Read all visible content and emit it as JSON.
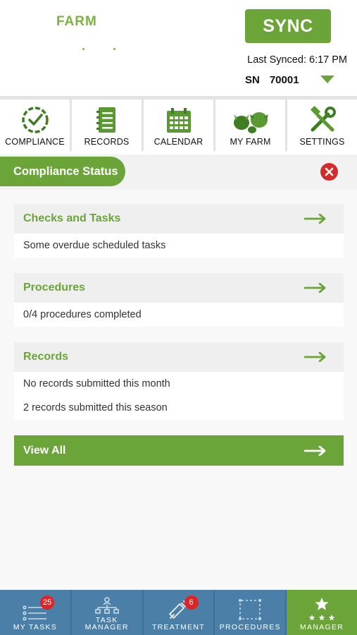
{
  "header": {
    "logo_text": "FARM",
    "sync_label": "SYNC",
    "last_synced": "Last Synced: 6:17 PM",
    "sn_label": "SN",
    "sn_value": "70001"
  },
  "topnav": [
    {
      "label": "COMPLIANCE",
      "icon": "compliance-check-icon"
    },
    {
      "label": "RECORDS",
      "icon": "records-icon"
    },
    {
      "label": "CALENDAR",
      "icon": "calendar-icon"
    },
    {
      "label": "MY FARM",
      "icon": "farm-animals-icon"
    },
    {
      "label": "SETTINGS",
      "icon": "tools-icon"
    }
  ],
  "compliance": {
    "title": "Compliance Status",
    "sections": [
      {
        "title": "Checks and Tasks",
        "lines": [
          "Some overdue scheduled tasks"
        ]
      },
      {
        "title": "Procedures",
        "lines": [
          "0/4 procedures completed"
        ]
      },
      {
        "title": "Records",
        "lines": [
          "No records submitted this month",
          "2 records submitted this season"
        ]
      }
    ],
    "view_all": "View All"
  },
  "tabbar": [
    {
      "label": "MY TASKS",
      "badge": "25",
      "icon": "task-list-icon"
    },
    {
      "label": "TASK MANAGER",
      "label_line1": "TASK",
      "label_line2": "MANAGER",
      "icon": "org-chart-icon"
    },
    {
      "label": "TREATMENT",
      "badge": "6",
      "icon": "syringe-icon"
    },
    {
      "label": "PROCEDURES",
      "icon": "procedures-icon"
    },
    {
      "label": "MANAGER",
      "icon": "star-icon",
      "active": true
    }
  ],
  "colors": {
    "brand_green": "#6ba539",
    "tab_blue": "#4c7fa8",
    "alert_red": "#d42a2a"
  }
}
